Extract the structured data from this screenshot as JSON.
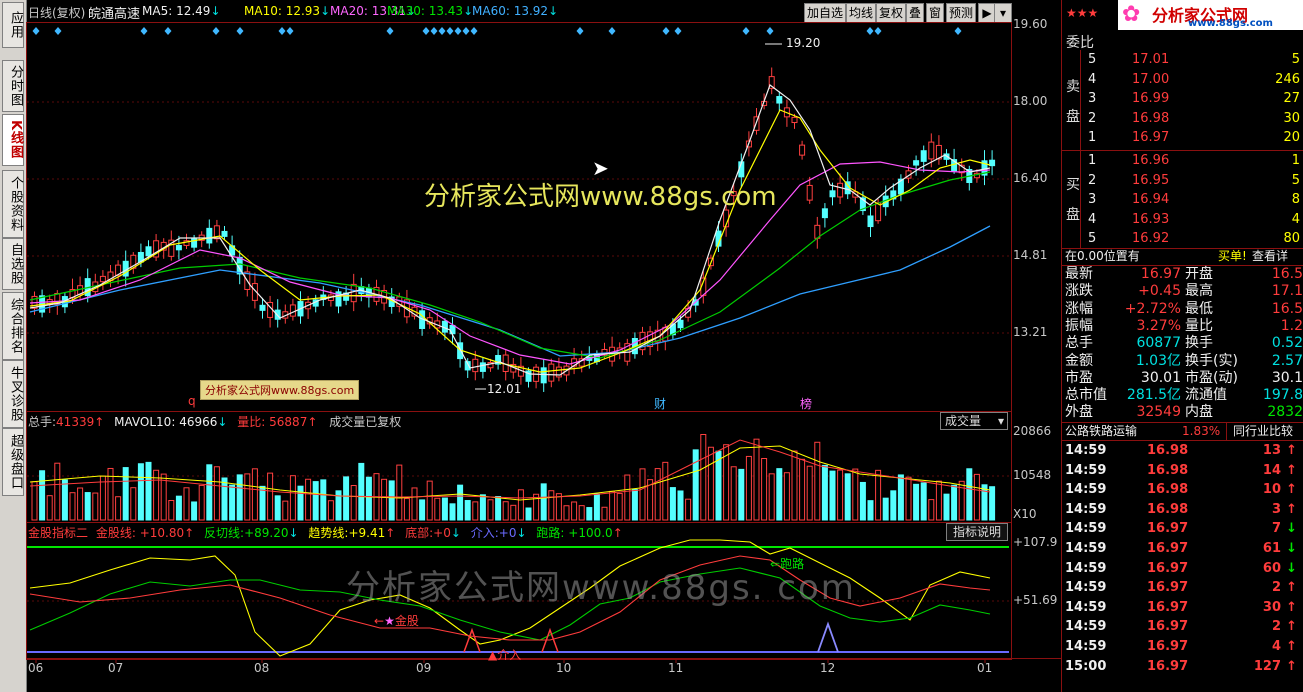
{
  "left_tabs": [
    {
      "label": "应用",
      "active": false
    },
    {
      "label": "分时图",
      "active": false
    },
    {
      "label": "K线图",
      "active": true
    },
    {
      "label": "个股资料",
      "active": false
    },
    {
      "label": "自选股",
      "active": false
    },
    {
      "label": "综合排名",
      "active": false
    },
    {
      "label": "牛叉诊股",
      "active": false
    },
    {
      "label": "超级盘口",
      "active": false
    }
  ],
  "top": {
    "period": "日线(复权)",
    "stock_name": "皖通高速",
    "ma": [
      {
        "label": "MA5:",
        "value": "12.49",
        "color": "#f0f0f0"
      },
      {
        "label": "MA10:",
        "value": "12.93",
        "color": "#ffff00"
      },
      {
        "label": "MA20:",
        "value": "13.31",
        "color": "#ff66ff"
      },
      {
        "label": "MA30:",
        "value": "13.43",
        "color": "#00e600"
      },
      {
        "label": "MA60:",
        "value": "13.92",
        "color": "#40b0ff"
      }
    ],
    "buttons": [
      "加自选",
      "均线",
      "复权",
      "叠",
      "窗",
      "预测"
    ],
    "more_icon": "▶"
  },
  "price_axis": [
    "19.60",
    "18.00",
    "16.40",
    "14.81",
    "13.21"
  ],
  "annotations": {
    "high": "19.20",
    "low": "12.01",
    "cai": "财",
    "bang": "榜",
    "q": "q"
  },
  "watermark_small": "分析家公式网www.88gs.com",
  "watermark_main": "分析家公式网www.88gs.com",
  "watermark_bottom": "分析家公式网www.88gs. com",
  "volume": {
    "total_label": "总手:",
    "total_value": "41339",
    "mavol_label": "MAVOL10:",
    "mavol_value": "46966",
    "ratio_label": "量比:",
    "ratio_value": "56887",
    "note": "成交量已复权",
    "selector": "成交量",
    "axis_top": "20866",
    "axis_mid": "10548",
    "axis_unit": "X10"
  },
  "indicator": {
    "name": "金股指标二",
    "items": [
      {
        "label": "金股线:",
        "value": "+10.80",
        "color": "#ff3c3c",
        "arrow": "↑"
      },
      {
        "label": "反切线:",
        "value": "+89.20",
        "color": "#00e600",
        "arrow": "↓"
      },
      {
        "label": "趋势线:",
        "value": "+9.41",
        "color": "#ffff00",
        "arrow": "↑"
      },
      {
        "label": "底部:",
        "value": "+0",
        "color": "#ff3c3c",
        "arrow": "↓"
      },
      {
        "label": "介入:",
        "value": "+0",
        "color": "#6a6aff",
        "arrow": "↓"
      },
      {
        "label": "跑路:",
        "value": "+100.0",
        "color": "#00e600",
        "arrow": "↑"
      }
    ],
    "explain_button": "指标说明",
    "axis_top": "+107.9",
    "axis_mid": "+51.69",
    "tag_paolu": "跑路",
    "tag_jingu": "金股",
    "tag_jieru": "介入"
  },
  "months": [
    "06",
    "07",
    "08",
    "09",
    "10",
    "11",
    "12",
    "01"
  ],
  "right": {
    "logo_text": "分析家公式网",
    "logo_url": "www.88gs.com",
    "weibi_label": "委比",
    "sell_label": "卖盘",
    "buy_label": "买盘",
    "sell": [
      {
        "lvl": "5",
        "price": "17.01",
        "vol": "5"
      },
      {
        "lvl": "4",
        "price": "17.00",
        "vol": "246"
      },
      {
        "lvl": "3",
        "price": "16.99",
        "vol": "27"
      },
      {
        "lvl": "2",
        "price": "16.98",
        "vol": "30"
      },
      {
        "lvl": "1",
        "price": "16.97",
        "vol": "20"
      }
    ],
    "buy": [
      {
        "lvl": "1",
        "price": "16.96",
        "vol": "1"
      },
      {
        "lvl": "2",
        "price": "16.95",
        "vol": "5"
      },
      {
        "lvl": "3",
        "price": "16.94",
        "vol": "8"
      },
      {
        "lvl": "4",
        "price": "16.93",
        "vol": "4"
      },
      {
        "lvl": "5",
        "price": "16.92",
        "vol": "80"
      }
    ],
    "position_text": "在0.00位置有",
    "buy_order": "买单!",
    "view_detail": "查看详",
    "stats": [
      {
        "l1": "最新",
        "v1": "16.97",
        "c1": "#ff3c3c",
        "l2": "开盘",
        "v2": "16.5",
        "c2": "#ff3c3c"
      },
      {
        "l1": "涨跌",
        "v1": "+0.45",
        "c1": "#ff3c3c",
        "l2": "最高",
        "v2": "17.1",
        "c2": "#ff3c3c"
      },
      {
        "l1": "涨幅",
        "v1": "+2.72%",
        "c1": "#ff3c3c",
        "l2": "最低",
        "v2": "16.5",
        "c2": "#ff3c3c"
      },
      {
        "l1": "振幅",
        "v1": "3.27%",
        "c1": "#ff3c3c",
        "l2": "量比",
        "v2": "1.2",
        "c2": "#ff3c3c"
      },
      {
        "l1": "总手",
        "v1": "60877",
        "c1": "#00e0e0",
        "l2": "换手",
        "v2": "0.52",
        "c2": "#00e0e0"
      },
      {
        "l1": "金额",
        "v1": "1.03亿",
        "c1": "#00e0e0",
        "l2": "换手(实)",
        "v2": "2.57",
        "c2": "#00e0e0"
      },
      {
        "l1": "市盈",
        "v1": "30.01",
        "c1": "#f0f0f0",
        "l2": "市盈(动)",
        "v2": "30.1",
        "c2": "#f0f0f0"
      },
      {
        "l1": "总市值",
        "v1": "281.5亿",
        "c1": "#00e0e0",
        "l2": "流通值",
        "v2": "197.8",
        "c2": "#00e0e0"
      },
      {
        "l1": "外盘",
        "v1": "32549",
        "c1": "#ff3c3c",
        "l2": "内盘",
        "v2": "2832",
        "c2": "#00e600"
      }
    ],
    "sector": "公路铁路运输",
    "sector_pct": "1.83%",
    "compare": "同行业比较",
    "ticks": [
      {
        "t": "14:59",
        "p": "16.98",
        "v": "13",
        "up": true
      },
      {
        "t": "14:59",
        "p": "16.98",
        "v": "14",
        "up": true
      },
      {
        "t": "14:59",
        "p": "16.98",
        "v": "10",
        "up": true
      },
      {
        "t": "14:59",
        "p": "16.98",
        "v": "3",
        "up": true
      },
      {
        "t": "14:59",
        "p": "16.97",
        "v": "7",
        "up": false
      },
      {
        "t": "14:59",
        "p": "16.97",
        "v": "61",
        "up": false
      },
      {
        "t": "14:59",
        "p": "16.97",
        "v": "60",
        "up": false
      },
      {
        "t": "14:59",
        "p": "16.97",
        "v": "2",
        "up": true
      },
      {
        "t": "14:59",
        "p": "16.97",
        "v": "30",
        "up": true
      },
      {
        "t": "14:59",
        "p": "16.97",
        "v": "2",
        "up": true
      },
      {
        "t": "14:59",
        "p": "16.97",
        "v": "4",
        "up": true
      },
      {
        "t": "15:00",
        "p": "16.97",
        "v": "127",
        "up": true
      }
    ]
  }
}
